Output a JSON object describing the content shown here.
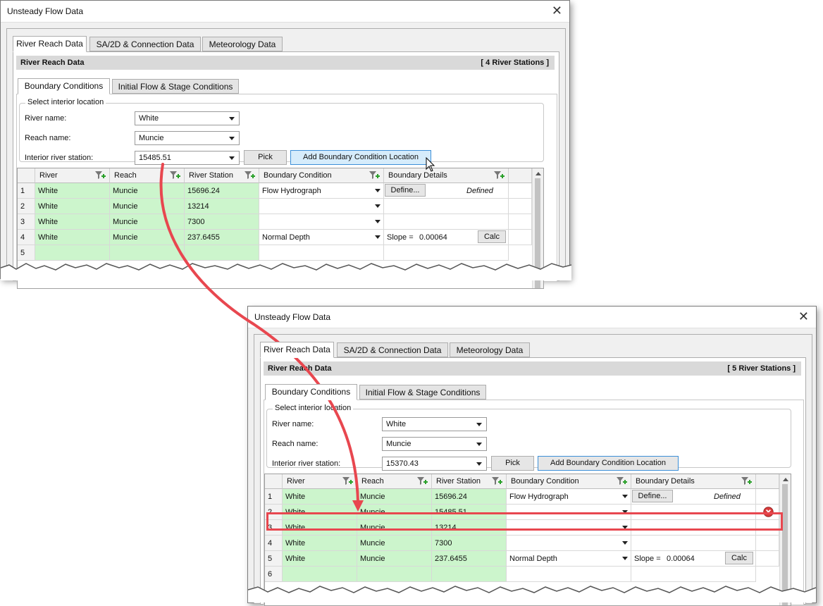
{
  "colors": {
    "grid_green": "#ccf5cc",
    "highlight_red": "#e8474f",
    "button_hover": "#d6ecfb"
  },
  "before": {
    "title": "Unsteady Flow Data",
    "tabs": [
      "River Reach Data",
      "SA/2D & Connection Data",
      "Meteorology Data"
    ],
    "section_title": "River Reach Data",
    "station_count": "[ 4 River Stations ]",
    "subtabs": [
      "Boundary Conditions",
      "Initial Flow & Stage Conditions"
    ],
    "location_group": "Select interior location",
    "river_name_label": "River name:",
    "river_name": "White",
    "reach_name_label": "Reach name:",
    "reach_name": "Muncie",
    "station_label": "Interior river station:",
    "station": "15485.51",
    "pick_label": "Pick",
    "add_label": "Add Boundary Condition Location",
    "columns": [
      "River",
      "Reach",
      "River Station",
      "Boundary Condition",
      "Boundary Details"
    ],
    "rows": [
      {
        "n": "1",
        "river": "White",
        "reach": "Muncie",
        "station": "15696.24",
        "bc": "Flow Hydrograph",
        "define": "Define...",
        "defined": "Defined"
      },
      {
        "n": "2",
        "river": "White",
        "reach": "Muncie",
        "station": "13214",
        "bc": ""
      },
      {
        "n": "3",
        "river": "White",
        "reach": "Muncie",
        "station": "7300",
        "bc": ""
      },
      {
        "n": "4",
        "river": "White",
        "reach": "Muncie",
        "station": "237.6455",
        "bc": "Normal Depth",
        "slope_label": "Slope =",
        "slope": "0.00064",
        "calc": "Calc"
      },
      {
        "n": "5",
        "river": "",
        "reach": "",
        "station": "",
        "bc": ""
      }
    ]
  },
  "after": {
    "title": "Unsteady Flow Data",
    "tabs": [
      "River Reach Data",
      "SA/2D & Connection Data",
      "Meteorology Data"
    ],
    "section_title": "River Reach Data",
    "station_count": "[ 5 River Stations ]",
    "subtabs": [
      "Boundary Conditions",
      "Initial Flow & Stage Conditions"
    ],
    "location_group": "Select interior location",
    "river_name_label": "River name:",
    "river_name": "White",
    "reach_name_label": "Reach name:",
    "reach_name": "Muncie",
    "station_label": "Interior river station:",
    "station": "15370.43",
    "pick_label": "Pick",
    "add_label": "Add Boundary Condition Location",
    "columns": [
      "River",
      "Reach",
      "River Station",
      "Boundary Condition",
      "Boundary Details"
    ],
    "rows": [
      {
        "n": "1",
        "river": "White",
        "reach": "Muncie",
        "station": "15696.24",
        "bc": "Flow Hydrograph",
        "define": "Define...",
        "defined": "Defined"
      },
      {
        "n": "2",
        "river": "White",
        "reach": "Muncie",
        "station": "15485.51",
        "bc": ""
      },
      {
        "n": "3",
        "river": "White",
        "reach": "Muncie",
        "station": "13214",
        "bc": ""
      },
      {
        "n": "4",
        "river": "White",
        "reach": "Muncie",
        "station": "7300",
        "bc": ""
      },
      {
        "n": "5",
        "river": "White",
        "reach": "Muncie",
        "station": "237.6455",
        "bc": "Normal Depth",
        "slope_label": "Slope =",
        "slope": "0.00064",
        "calc": "Calc"
      },
      {
        "n": "6",
        "river": "",
        "reach": "",
        "station": "",
        "bc": ""
      }
    ]
  }
}
